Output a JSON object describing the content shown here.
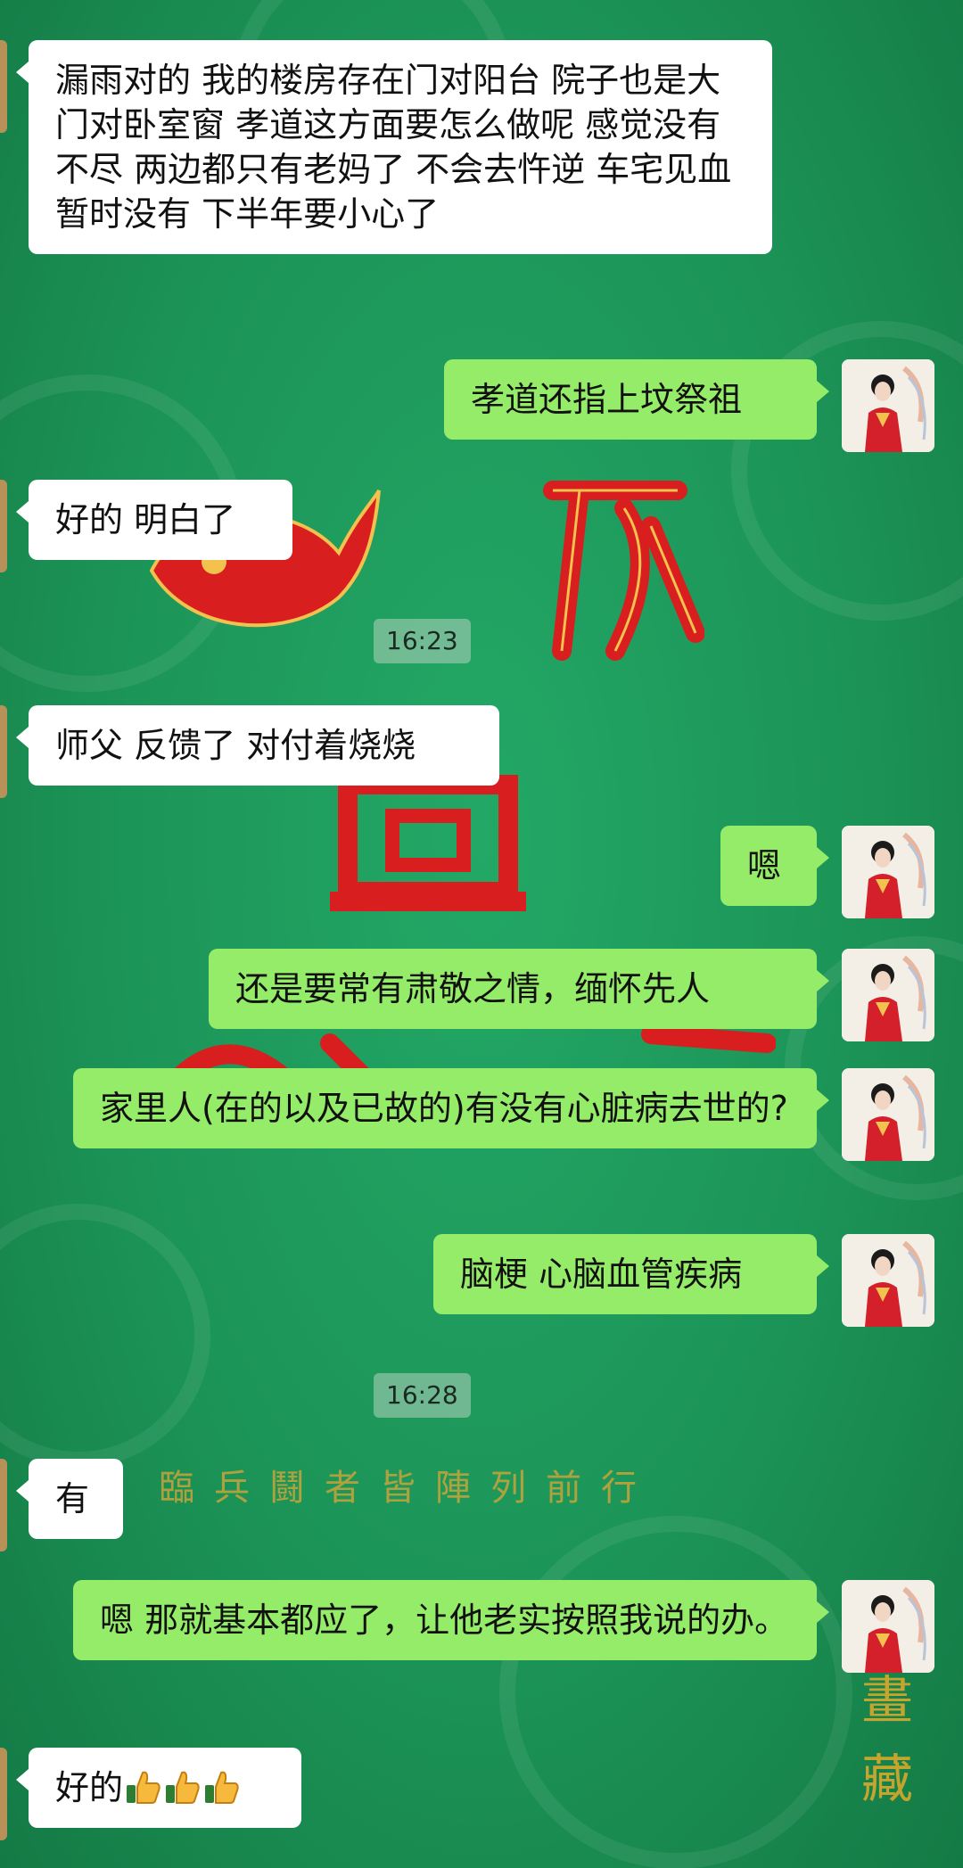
{
  "background": {
    "poster_text": "臨兵鬪者皆陣列前行",
    "vertical_text": [
      "畫",
      "藏"
    ],
    "colors": {
      "green": "#1f9a5e",
      "red": "#d81e1e",
      "gold": "#c8a43a"
    }
  },
  "chat": {
    "timestamps": [
      "16:23",
      "16:28"
    ],
    "messages": [
      {
        "side": "left",
        "text": "漏雨对的 我的楼房存在门对阳台 院子也是大门对卧室窗 孝道这方面要怎么做呢 感觉没有不尽 两边都只有老妈了 不会去忤逆  车宅见血暂时没有  下半年要小心了"
      },
      {
        "side": "right",
        "text": "孝道还指上坟祭祖"
      },
      {
        "side": "left",
        "text": "好的 明白了"
      },
      {
        "side": "left",
        "text": "师父 反馈了 对付着烧烧"
      },
      {
        "side": "right",
        "text": "嗯"
      },
      {
        "side": "right",
        "text": "还是要常有肃敬之情，缅怀先人"
      },
      {
        "side": "right",
        "text": "家里人(在的以及已故的)有没有心脏病去世的?"
      },
      {
        "side": "right",
        "text": "脑梗 心脑血管疾病"
      },
      {
        "side": "left",
        "text": "有"
      },
      {
        "side": "right",
        "text": "嗯 那就基本都应了，让他老实按照我说的办。"
      },
      {
        "side": "left",
        "text": "好的",
        "emoji": [
          "thumbs-up",
          "thumbs-up",
          "thumbs-up"
        ]
      }
    ]
  }
}
